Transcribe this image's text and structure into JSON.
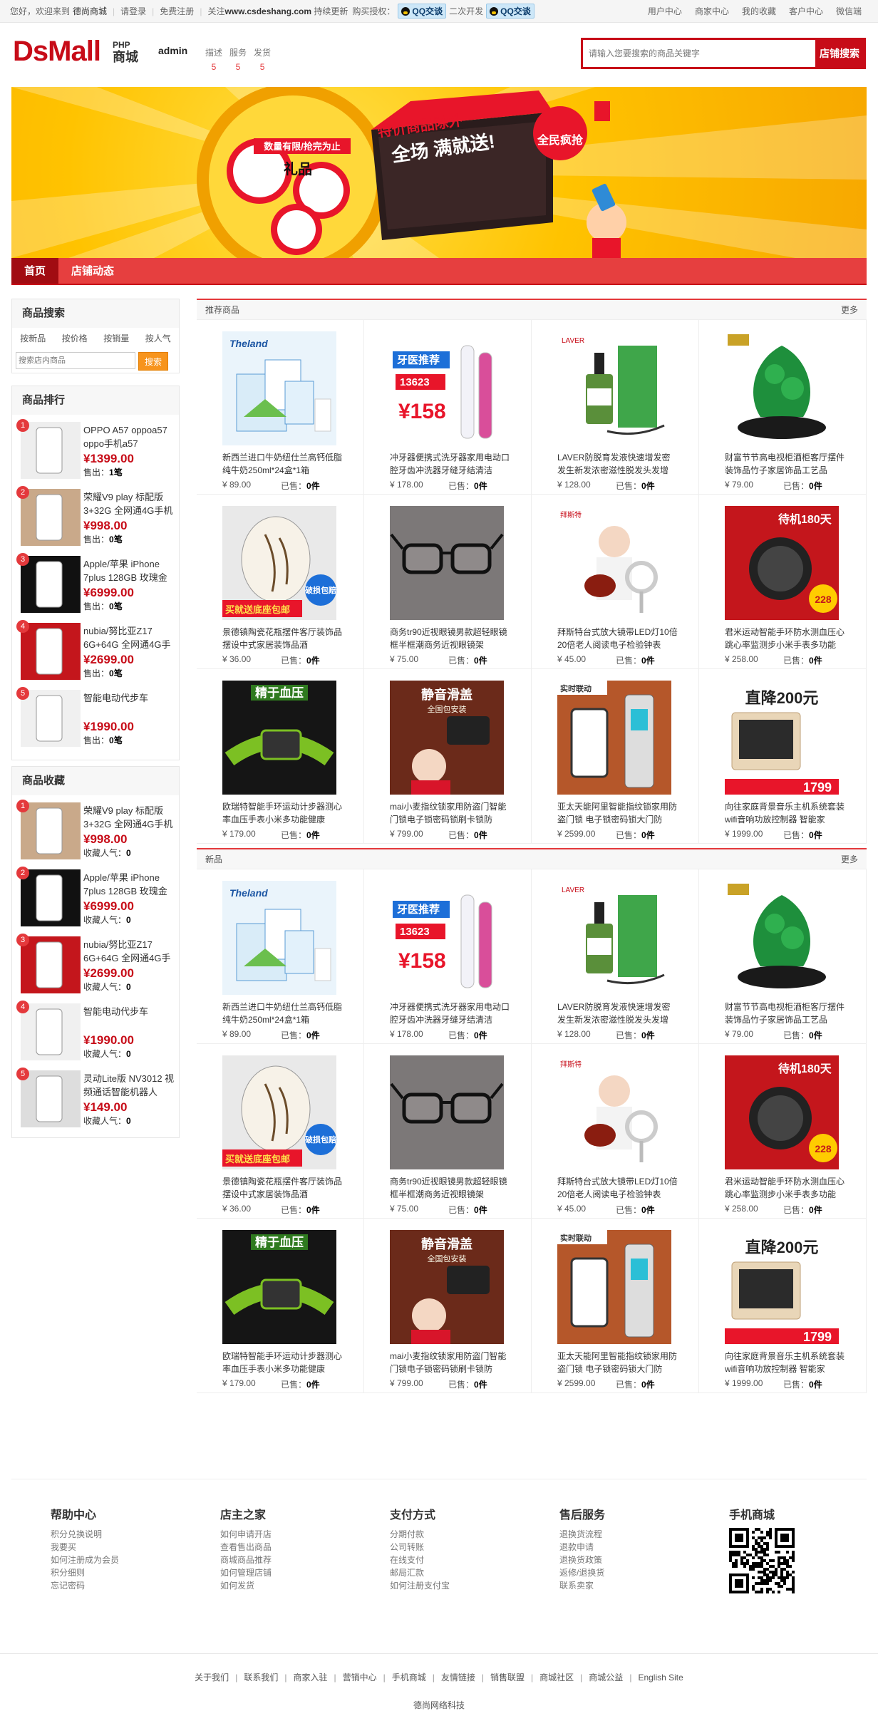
{
  "topbar": {
    "welcome": "您好，欢迎来到",
    "site": "德尚商城",
    "login": "请登录",
    "register": "免费注册",
    "notice_pre": "关注",
    "notice_url": "www.csdeshang.com",
    "notice_post": "持续更新",
    "buy_auth": "购买授权：",
    "qq1": "QQ交谈",
    "dev": "二次开发",
    "qq2": "QQ交谈",
    "menu": [
      "用户中心",
      "商家中心",
      "我的收藏",
      "客户中心",
      "微信端"
    ]
  },
  "header": {
    "logo_ds": "Ds",
    "logo_mall": "Mall",
    "logo_php": "PHP",
    "logo_sc": "商城",
    "shop_name": "admin",
    "score_labels": [
      "描述",
      "服务",
      "发货"
    ],
    "score_values": [
      "5",
      "5",
      "5"
    ],
    "search_placeholder": "请输入您要搜索的商品关键字",
    "search_button": "店铺搜索"
  },
  "banner": {
    "tag": "数量有限/抢完为止",
    "gift": "礼品",
    "headline1": "特价商品除外",
    "headline2": "全场 满就送!",
    "badge": "全民疯抢"
  },
  "nav": [
    "首页",
    "店铺动态"
  ],
  "search_panel": {
    "title": "商品搜索",
    "tabs": [
      "按新品",
      "按价格",
      "按销量",
      "按人气"
    ],
    "placeholder": "搜索店内商品",
    "button": "搜索"
  },
  "ranking": {
    "title": "商品排行",
    "items": [
      {
        "n": "1",
        "name": "OPPO A57 oppoa57 oppo手机a57",
        "price": "1399.00",
        "label": "售出：",
        "value": "1笔"
      },
      {
        "n": "2",
        "name": "荣耀V9 play 标配版 3+32G 全网通4G手机",
        "price": "998.00",
        "label": "售出：",
        "value": "0笔"
      },
      {
        "n": "3",
        "name": "Apple/苹果 iPhone 7plus 128GB 玫瑰金",
        "price": "6999.00",
        "label": "售出：",
        "value": "0笔"
      },
      {
        "n": "4",
        "name": "nubia/努比亚Z17 6G+64G 全网通4G手",
        "price": "2699.00",
        "label": "售出：",
        "value": "0笔"
      },
      {
        "n": "5",
        "name": "智能电动代步车",
        "price": "1990.00",
        "label": "售出：",
        "value": "0笔"
      }
    ]
  },
  "favorites": {
    "title": "商品收藏",
    "items": [
      {
        "n": "1",
        "name": "荣耀V9 play 标配版 3+32G 全网通4G手机",
        "price": "998.00",
        "label": "收藏人气：",
        "value": "0"
      },
      {
        "n": "2",
        "name": "Apple/苹果 iPhone 7plus 128GB 玫瑰金",
        "price": "6999.00",
        "label": "收藏人气：",
        "value": "0"
      },
      {
        "n": "3",
        "name": "nubia/努比亚Z17 6G+64G 全网通4G手",
        "price": "2699.00",
        "label": "收藏人气：",
        "value": "0"
      },
      {
        "n": "4",
        "name": "智能电动代步车",
        "price": "1990.00",
        "label": "收藏人气：",
        "value": "0"
      },
      {
        "n": "5",
        "name": "灵动Lite版 NV3012 视频通话智能机器人",
        "price": "149.00",
        "label": "收藏人气：",
        "value": "0"
      }
    ]
  },
  "sections": [
    {
      "title": "推荐商品",
      "more": "更多"
    },
    {
      "title": "新品",
      "more": "更多"
    }
  ],
  "products": [
    {
      "name": "新西兰进口牛奶纽仕兰高钙低脂纯牛奶250ml*24盒*1箱",
      "price": "¥ 89.00",
      "sold_label": "已售：",
      "sold": "0件",
      "img": "milk"
    },
    {
      "name": "冲牙器便携式洗牙器家用电动口腔牙齿冲洗器牙缝牙结清洁",
      "price": "¥ 178.00",
      "sold_label": "已售：",
      "sold": "0件",
      "img": "flosser"
    },
    {
      "name": "LAVER防脱育发液快速增发密发生新发浓密滋性脱发头发增",
      "price": "¥ 128.00",
      "sold_label": "已售：",
      "sold": "0件",
      "img": "bottle"
    },
    {
      "name": "财富节节高电视柜酒柜客厅摆件装饰品竹子家居饰品工艺品",
      "price": "¥ 79.00",
      "sold_label": "已售：",
      "sold": "0件",
      "img": "jade"
    },
    {
      "name": "景德镇陶瓷花瓶摆件客厅装饰品摆设中式家居装饰品酒",
      "price": "¥ 36.00",
      "sold_label": "已售：",
      "sold": "0件",
      "img": "vase"
    },
    {
      "name": "商务tr90近视眼镜男款超轻眼镜框半框潮商务近视眼镜架",
      "price": "¥ 75.00",
      "sold_label": "已售：",
      "sold": "0件",
      "img": "glasses"
    },
    {
      "name": "拜斯特台式放大镜带LED灯10倍20倍老人阅读电子检验钟表",
      "price": "¥ 45.00",
      "sold_label": "已售：",
      "sold": "0件",
      "img": "magnifier"
    },
    {
      "name": "君米运动智能手环防水测血压心跳心率监测步小米手表多功能",
      "price": "¥ 258.00",
      "sold_label": "已售：",
      "sold": "0件",
      "img": "watch"
    },
    {
      "name": "欧瑞特智能手环运动计步器测心率血压手表小米多功能健康",
      "price": "¥ 179.00",
      "sold_label": "已售：",
      "sold": "0件",
      "img": "band"
    },
    {
      "name": "mai小麦指纹锁家用防盗门智能门锁电子锁密码锁刷卡锁防",
      "price": "¥ 799.00",
      "sold_label": "已售：",
      "sold": "0件",
      "img": "lock"
    },
    {
      "name": "亚太天能阿里智能指纹锁家用防盗门锁 电子锁密码锁大门防",
      "price": "¥ 2599.00",
      "sold_label": "已售：",
      "sold": "0件",
      "img": "lock2"
    },
    {
      "name": "向往家庭背景音乐主机系统套装 wifi音响功放控制器 智能家",
      "price": "¥ 1999.00",
      "sold_label": "已售：",
      "sold": "0件",
      "img": "panel"
    }
  ],
  "product_tags": {
    "milk_brand": "Theland",
    "flosser_title": "牙医推荐",
    "flosser_num": "13623",
    "flosser_price": "158",
    "laver": "LAVER",
    "vase_tag": "买就送底座包邮",
    "vase_badge": "破损包赔",
    "magnifier_brand": "拜斯特",
    "watch_top": "待机180天",
    "watch_price": "228",
    "band_title": "精于血压",
    "lock_title": "静音滑盖",
    "lock_sub": "全国包安装",
    "lock2_tag": "实时联动",
    "panel_title": "直降200元",
    "panel_price": "1799"
  },
  "footer": {
    "cols": [
      {
        "title": "帮助中心",
        "links": [
          "积分兑换说明",
          "我要买",
          "如何注册成为会员",
          "积分细则",
          "忘记密码"
        ]
      },
      {
        "title": "店主之家",
        "links": [
          "如何申请开店",
          "查看售出商品",
          "商城商品推荐",
          "如何管理店铺",
          "如何发货"
        ]
      },
      {
        "title": "支付方式",
        "links": [
          "分期付款",
          "公司转账",
          "在线支付",
          "邮局汇款",
          "如何注册支付宝"
        ]
      },
      {
        "title": "售后服务",
        "links": [
          "退换货流程",
          "退款申请",
          "退换货政策",
          "返修/退换货",
          "联系卖家"
        ]
      },
      {
        "title": "手机商城",
        "links": []
      }
    ],
    "links": [
      "关于我们",
      "联系我们",
      "商家入驻",
      "营销中心",
      "手机商城",
      "友情链接",
      "销售联盟",
      "商城社区",
      "商城公益",
      "English Site"
    ],
    "copyright": "德尚网络科技"
  },
  "colors": {
    "brand": "#c70c18",
    "nav": "#e63f3f",
    "price": "#e4393c"
  }
}
